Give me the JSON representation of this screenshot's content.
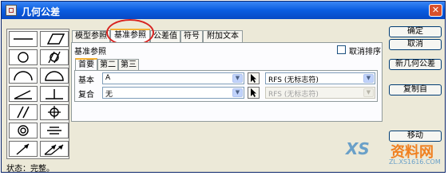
{
  "window": {
    "title": "几何公差",
    "close_glyph": "✕"
  },
  "symbol_palette": [
    {
      "name": "straightness-icon",
      "shape": "straightness"
    },
    {
      "name": "flatness-icon",
      "shape": "flatness"
    },
    {
      "name": "circularity-icon",
      "shape": "circularity"
    },
    {
      "name": "cylindricity-icon",
      "shape": "cylindricity"
    },
    {
      "name": "line-profile-icon",
      "shape": "line-profile"
    },
    {
      "name": "surface-profile-icon",
      "shape": "surface-profile"
    },
    {
      "name": "angularity-icon",
      "shape": "angularity"
    },
    {
      "name": "perpendicularity-icon",
      "shape": "perpendicularity"
    },
    {
      "name": "parallelism-icon",
      "shape": "parallelism"
    },
    {
      "name": "position-icon",
      "shape": "position"
    },
    {
      "name": "concentricity-icon",
      "shape": "concentricity"
    },
    {
      "name": "symmetry-icon",
      "shape": "symmetry"
    },
    {
      "name": "circular-runout-icon",
      "shape": "circular-runout"
    },
    {
      "name": "total-runout-icon",
      "shape": "total-runout"
    }
  ],
  "tabs": [
    {
      "label": "模型参照",
      "active": false
    },
    {
      "label": "基准参照",
      "active": true
    },
    {
      "label": "公差值",
      "active": false
    },
    {
      "label": "符号",
      "active": false
    },
    {
      "label": "附加文本",
      "active": false
    }
  ],
  "panel": {
    "title": "基准参照",
    "checkbox_label": "取消排序",
    "inner_tabs": [
      {
        "label": "首要",
        "active": true
      },
      {
        "label": "第二",
        "active": false
      },
      {
        "label": "第三",
        "active": false
      }
    ],
    "rows": [
      {
        "label": "基本",
        "value": "A",
        "modifier": "RFS (无标志符)",
        "modifier_disabled": false
      },
      {
        "label": "复合",
        "value": "无",
        "modifier": "RFS (无标志符)",
        "modifier_disabled": true
      }
    ]
  },
  "buttons": {
    "ok": "确定",
    "cancel": "取消",
    "new_gtol": "新几何公差",
    "copy_from": "复制自",
    "move": "移动"
  },
  "status": "状态：完整。",
  "watermark": {
    "logo": "XS",
    "text": "资料网",
    "url": "ZL.XS1616.COM"
  },
  "colors": {
    "titlebar": "#0a5ce0",
    "highlight_ring": "#d72320",
    "active_tab_accent": "#f5b133"
  }
}
